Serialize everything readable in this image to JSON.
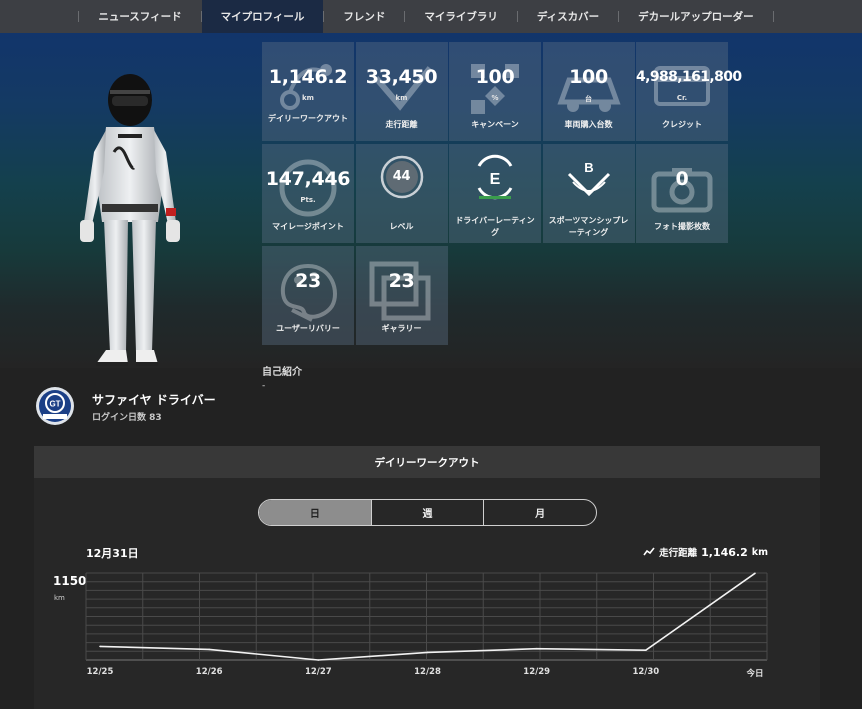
{
  "nav": {
    "items": [
      {
        "label": "ニュースフィード"
      },
      {
        "label": "マイプロフィール",
        "active": true
      },
      {
        "label": "フレンド"
      },
      {
        "label": "マイライブラリ"
      },
      {
        "label": "ディスカバー"
      },
      {
        "label": "デカールアップローダー"
      }
    ]
  },
  "profile": {
    "name": "サファイヤ ドライバー",
    "login_days": "ログイン日数 83",
    "intro_title": "自己紹介",
    "intro_text": "-"
  },
  "stats": [
    {
      "value": "1,146.2",
      "unit": "km",
      "label": "デイリーワークアウト",
      "icon": "route-icon"
    },
    {
      "value": "33,450",
      "unit": "km",
      "label": "走行距離",
      "icon": "speed-icon"
    },
    {
      "value": "100",
      "unit": "%",
      "label": "キャンペーン",
      "icon": "campaign-icon"
    },
    {
      "value": "100",
      "unit": "台",
      "label": "車両購入台数",
      "icon": "car-icon"
    },
    {
      "value": "4,988,161,800",
      "unit": "Cr.",
      "label": "クレジット",
      "icon": "credit-icon"
    },
    {
      "value": "147,446",
      "unit": "Pts.",
      "label": "マイレージポイント",
      "icon": "mileage-icon"
    },
    {
      "value": "44",
      "unit": "",
      "label": "レベル",
      "icon": "level-badge-icon"
    },
    {
      "value": "",
      "unit": "",
      "label": "ドライバーレーティング",
      "icon": "driver-rating-e-icon"
    },
    {
      "value": "",
      "unit": "",
      "label": "スポーツマンシップレーティング",
      "icon": "sportsmanship-rating-b-icon"
    },
    {
      "value": "0",
      "unit": "",
      "label": "フォト撮影枚数",
      "icon": "camera-icon"
    },
    {
      "value": "23",
      "unit": "",
      "label": "ユーザーリバリー",
      "icon": "palette-icon"
    },
    {
      "value": "23",
      "unit": "",
      "label": "ギャラリー",
      "icon": "gallery-icon"
    }
  ],
  "ratings": {
    "driver": "E",
    "sportsmanship": "B"
  },
  "workout": {
    "title": "デイリーワークアウト",
    "tabs": [
      {
        "label": "日",
        "active": true
      },
      {
        "label": "週"
      },
      {
        "label": "月"
      }
    ],
    "date": "12月31日",
    "distance_label": "走行距離",
    "distance_value": "1,146.2",
    "distance_unit": "km",
    "y_top_label": "1150",
    "y_unit": "km"
  },
  "colors": {
    "nav_bg": "#3d3f44",
    "nav_active": "#1b2a44",
    "tile_bg": "#5a6e82",
    "panel_head": "#383838",
    "panel_body": "#272727"
  },
  "chart_data": {
    "type": "line",
    "title": "",
    "xlabel": "",
    "ylabel": "km",
    "categories": [
      "12/25",
      "12/26",
      "12/27",
      "12/28",
      "12/29",
      "12/30",
      "今日"
    ],
    "values": [
      180,
      140,
      0,
      100,
      150,
      130,
      1146.2
    ],
    "ylim": [
      0,
      1150
    ],
    "grid": true,
    "legend": "none"
  }
}
